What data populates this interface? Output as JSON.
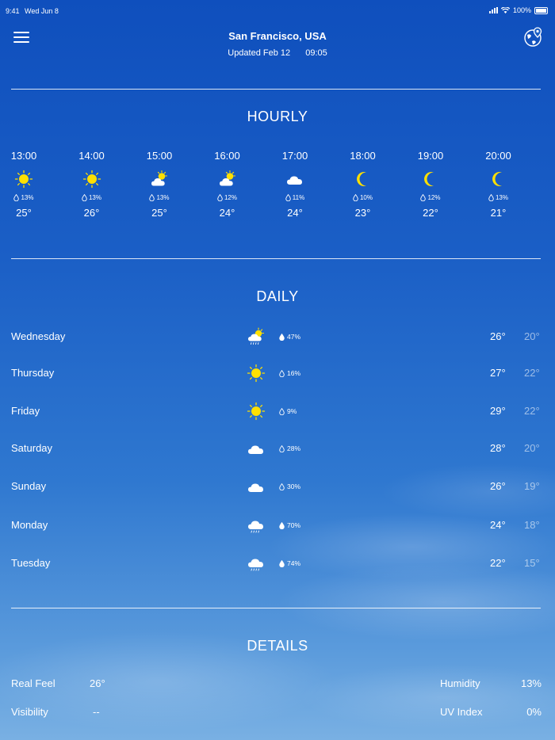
{
  "status": {
    "time": "9:41",
    "date": "Wed Jun 8",
    "battery": "100%"
  },
  "header": {
    "city": "San Francisco, USA",
    "updated": "Updated Feb 12",
    "updated_time": "09:05"
  },
  "hourly": {
    "title": "HOURLY",
    "items": [
      {
        "time": "13:00",
        "icon": "sun",
        "precip": "13%",
        "temp": "25°"
      },
      {
        "time": "14:00",
        "icon": "sun",
        "precip": "13%",
        "temp": "26°"
      },
      {
        "time": "15:00",
        "icon": "sun-cloud",
        "precip": "13%",
        "temp": "25°"
      },
      {
        "time": "16:00",
        "icon": "sun-cloud",
        "precip": "12%",
        "temp": "24°"
      },
      {
        "time": "17:00",
        "icon": "cloud",
        "precip": "11%",
        "temp": "24°"
      },
      {
        "time": "18:00",
        "icon": "moon",
        "precip": "10%",
        "temp": "23°"
      },
      {
        "time": "19:00",
        "icon": "moon",
        "precip": "12%",
        "temp": "22°"
      },
      {
        "time": "20:00",
        "icon": "moon",
        "precip": "13%",
        "temp": "21°"
      }
    ]
  },
  "daily": {
    "title": "DAILY",
    "items": [
      {
        "day": "Wednesday",
        "icon": "sun-cloud-rain",
        "precip": "47%",
        "high": "26°",
        "low": "20°"
      },
      {
        "day": "Thursday",
        "icon": "sun",
        "precip": "16%",
        "high": "27°",
        "low": "22°"
      },
      {
        "day": "Friday",
        "icon": "sun",
        "precip": "9%",
        "high": "29°",
        "low": "22°"
      },
      {
        "day": "Saturday",
        "icon": "cloud",
        "precip": "28%",
        "high": "28°",
        "low": "20°"
      },
      {
        "day": "Sunday",
        "icon": "cloud",
        "precip": "30%",
        "high": "26°",
        "low": "19°"
      },
      {
        "day": "Monday",
        "icon": "cloud-rain",
        "precip": "70%",
        "high": "24°",
        "low": "18°"
      },
      {
        "day": "Tuesday",
        "icon": "cloud-rain",
        "precip": "74%",
        "high": "22°",
        "low": "15°"
      }
    ]
  },
  "details": {
    "title": "DETAILS",
    "real_feel_label": "Real Feel",
    "real_feel": "26°",
    "visibility_label": "Visibility",
    "visibility": "--",
    "humidity_label": "Humidity",
    "humidity": "13%",
    "uv_label": "UV Index",
    "uv": "0%"
  },
  "colors": {
    "sun": "#ffe000",
    "sky_top": "#0f4fbd",
    "sky_bottom": "#79b0e3"
  }
}
